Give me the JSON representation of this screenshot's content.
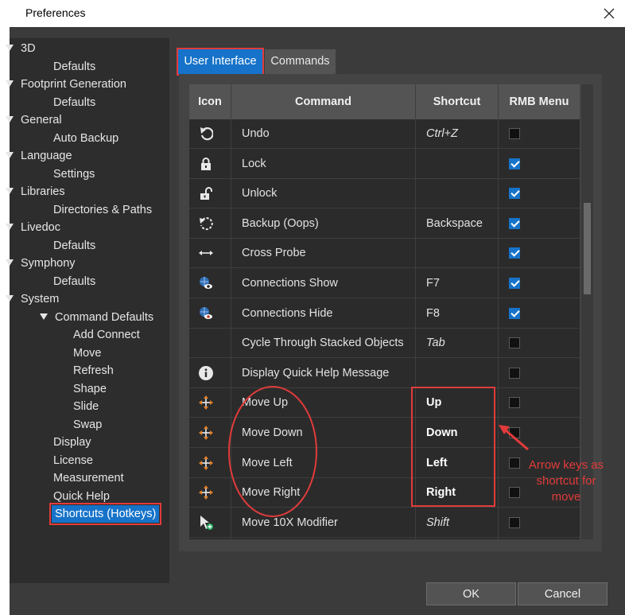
{
  "window": {
    "title": "Preferences"
  },
  "tree": {
    "items": [
      {
        "label": "3D",
        "level": 0,
        "expanded": true
      },
      {
        "label": "Defaults",
        "level": 1
      },
      {
        "label": "Footprint Generation",
        "level": 0,
        "expanded": true
      },
      {
        "label": "Defaults",
        "level": 1
      },
      {
        "label": "General",
        "level": 0,
        "expanded": true
      },
      {
        "label": "Auto Backup",
        "level": 1
      },
      {
        "label": "Language",
        "level": 0,
        "expanded": true
      },
      {
        "label": "Settings",
        "level": 1
      },
      {
        "label": "Libraries",
        "level": 0,
        "expanded": true
      },
      {
        "label": "Directories & Paths",
        "level": 1
      },
      {
        "label": "Livedoc",
        "level": 0,
        "expanded": true
      },
      {
        "label": "Defaults",
        "level": 1
      },
      {
        "label": "Symphony",
        "level": 0,
        "expanded": true
      },
      {
        "label": "Defaults",
        "level": 1
      },
      {
        "label": "System",
        "level": 0,
        "expanded": true
      },
      {
        "label": "Command Defaults",
        "level": 1,
        "expanded": true
      },
      {
        "label": "Add Connect",
        "level": 2
      },
      {
        "label": "Move",
        "level": 2
      },
      {
        "label": "Refresh",
        "level": 2
      },
      {
        "label": "Shape",
        "level": 2
      },
      {
        "label": "Slide",
        "level": 2
      },
      {
        "label": "Swap",
        "level": 2
      },
      {
        "label": "Display",
        "level": 1
      },
      {
        "label": "License",
        "level": 1
      },
      {
        "label": "Measurement",
        "level": 1
      },
      {
        "label": "Quick Help",
        "level": 1
      },
      {
        "label": "Shortcuts (Hotkeys)",
        "level": 1,
        "selected": true
      }
    ]
  },
  "tabs": [
    {
      "label": "User Interface",
      "active": true
    },
    {
      "label": "Commands",
      "active": false
    }
  ],
  "table": {
    "headers": {
      "icon": "Icon",
      "command": "Command",
      "shortcut": "Shortcut",
      "rmb": "RMB Menu"
    },
    "rows": [
      {
        "icon": "undo-icon",
        "command": "Undo",
        "shortcut": "Ctrl+Z",
        "style": "italic",
        "rmb": false
      },
      {
        "icon": "lock-icon",
        "command": "Lock",
        "shortcut": "",
        "style": "",
        "rmb": true
      },
      {
        "icon": "unlock-icon",
        "command": "Unlock",
        "shortcut": "",
        "style": "",
        "rmb": true
      },
      {
        "icon": "backup-icon",
        "command": "Backup (Oops)",
        "shortcut": "Backspace",
        "style": "",
        "rmb": true
      },
      {
        "icon": "cross-probe-icon",
        "command": "Cross Probe",
        "shortcut": "",
        "style": "",
        "rmb": true
      },
      {
        "icon": "connections-show-icon",
        "command": "Connections Show",
        "shortcut": "F7",
        "style": "",
        "rmb": true
      },
      {
        "icon": "connections-hide-icon",
        "command": "Connections Hide",
        "shortcut": "F8",
        "style": "",
        "rmb": true
      },
      {
        "icon": "",
        "command": "Cycle Through Stacked Objects",
        "shortcut": "Tab",
        "style": "italic",
        "rmb": false
      },
      {
        "icon": "info-icon",
        "command": "Display Quick Help Message",
        "shortcut": "",
        "style": "",
        "rmb": false
      },
      {
        "icon": "move-icon",
        "command": "Move Up",
        "shortcut": "Up",
        "style": "bold",
        "rmb": false
      },
      {
        "icon": "move-icon",
        "command": "Move Down",
        "shortcut": "Down",
        "style": "bold",
        "rmb": false
      },
      {
        "icon": "move-icon",
        "command": "Move Left",
        "shortcut": "Left",
        "style": "bold",
        "rmb": false
      },
      {
        "icon": "move-icon",
        "command": "Move Right",
        "shortcut": "Right",
        "style": "bold",
        "rmb": false
      },
      {
        "icon": "cursor-plus-icon",
        "command": "Move 10X Modifier",
        "shortcut": "Shift",
        "style": "italic",
        "rmb": false
      }
    ]
  },
  "annotation": {
    "text": "Arrow keys as shortcut for move"
  },
  "buttons": {
    "ok": "OK",
    "cancel": "Cancel"
  },
  "colors": {
    "accent": "#1673c9",
    "annotation": "#e23b3b",
    "background": "#3b3b3b"
  }
}
